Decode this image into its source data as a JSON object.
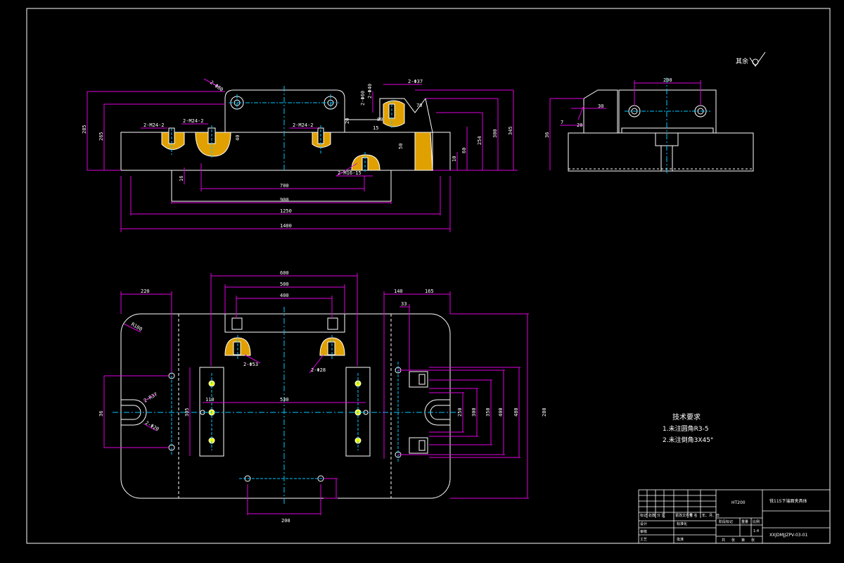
{
  "colors": {
    "background": "#000000",
    "outline": "#ffffff",
    "dimension": "#e000e0",
    "centerline": "#00c8ff",
    "hatch": "#e0a000",
    "hole": "#ffff00"
  },
  "roughness": {
    "label": "其余"
  },
  "front_view": {
    "dims": {
      "d285": "285",
      "d265": "265",
      "d700": "700",
      "d900": "900",
      "d1250": "1250",
      "d1400": "1400",
      "d16": "16",
      "d254": "254",
      "d300": "300",
      "d345": "345",
      "d60": "60",
      "d10": "10",
      "d40": "40",
      "d20": "20",
      "d80": "80",
      "d70": "70",
      "d15": "15",
      "d50": "50"
    },
    "notes": {
      "n1": "2-M24-2",
      "n2": "2-M24-2",
      "n3": "2-M24-2",
      "n4": "2-M16-15",
      "n5": "2-Φ80",
      "n6": "2-Φ37",
      "n7": "2-Φ60",
      "n8": "2-Φ40"
    }
  },
  "side_view": {
    "dims": {
      "d200": "200",
      "d30": "30",
      "d20": "20",
      "d7": "7",
      "d36": "36"
    }
  },
  "top_view": {
    "dims": {
      "d600": "600",
      "d500": "500",
      "d400": "400",
      "d140": "140",
      "d165": "165",
      "d33": "33",
      "d220": "220",
      "d530": "530",
      "d110": "110",
      "d300": "300",
      "d250": "250",
      "d350": "350",
      "d400b": "400",
      "d480": "480",
      "d280": "280",
      "d200": "200",
      "d36": "36",
      "d305": "305"
    },
    "notes": {
      "r1": "R100",
      "r2": "2-R37",
      "r3": "2-Φ20",
      "r4": "2-Φ53",
      "r5": "2-Φ28"
    }
  },
  "tech_requirements": {
    "title": "技术要求",
    "items": [
      "1.未注圆角R3-5",
      "2.未注倒角3X45°"
    ]
  },
  "title_block": {
    "material": "HT200",
    "drawing_name": "铣115下端面夹具体",
    "drawing_number": "XXJDMJJZPV-03-01",
    "row_labels": [
      "标记",
      "处数",
      "分 区",
      "更改文件号",
      "签 名",
      "年、月、日"
    ],
    "left_labels": [
      "设计",
      "审核",
      "工艺"
    ],
    "mid_labels": [
      "标准化",
      "批准"
    ],
    "stage_labels": [
      "阶段标记",
      "重量",
      "比例"
    ],
    "scale": "1:4",
    "sheet_labels": [
      "共",
      "张",
      "第",
      "张"
    ]
  }
}
